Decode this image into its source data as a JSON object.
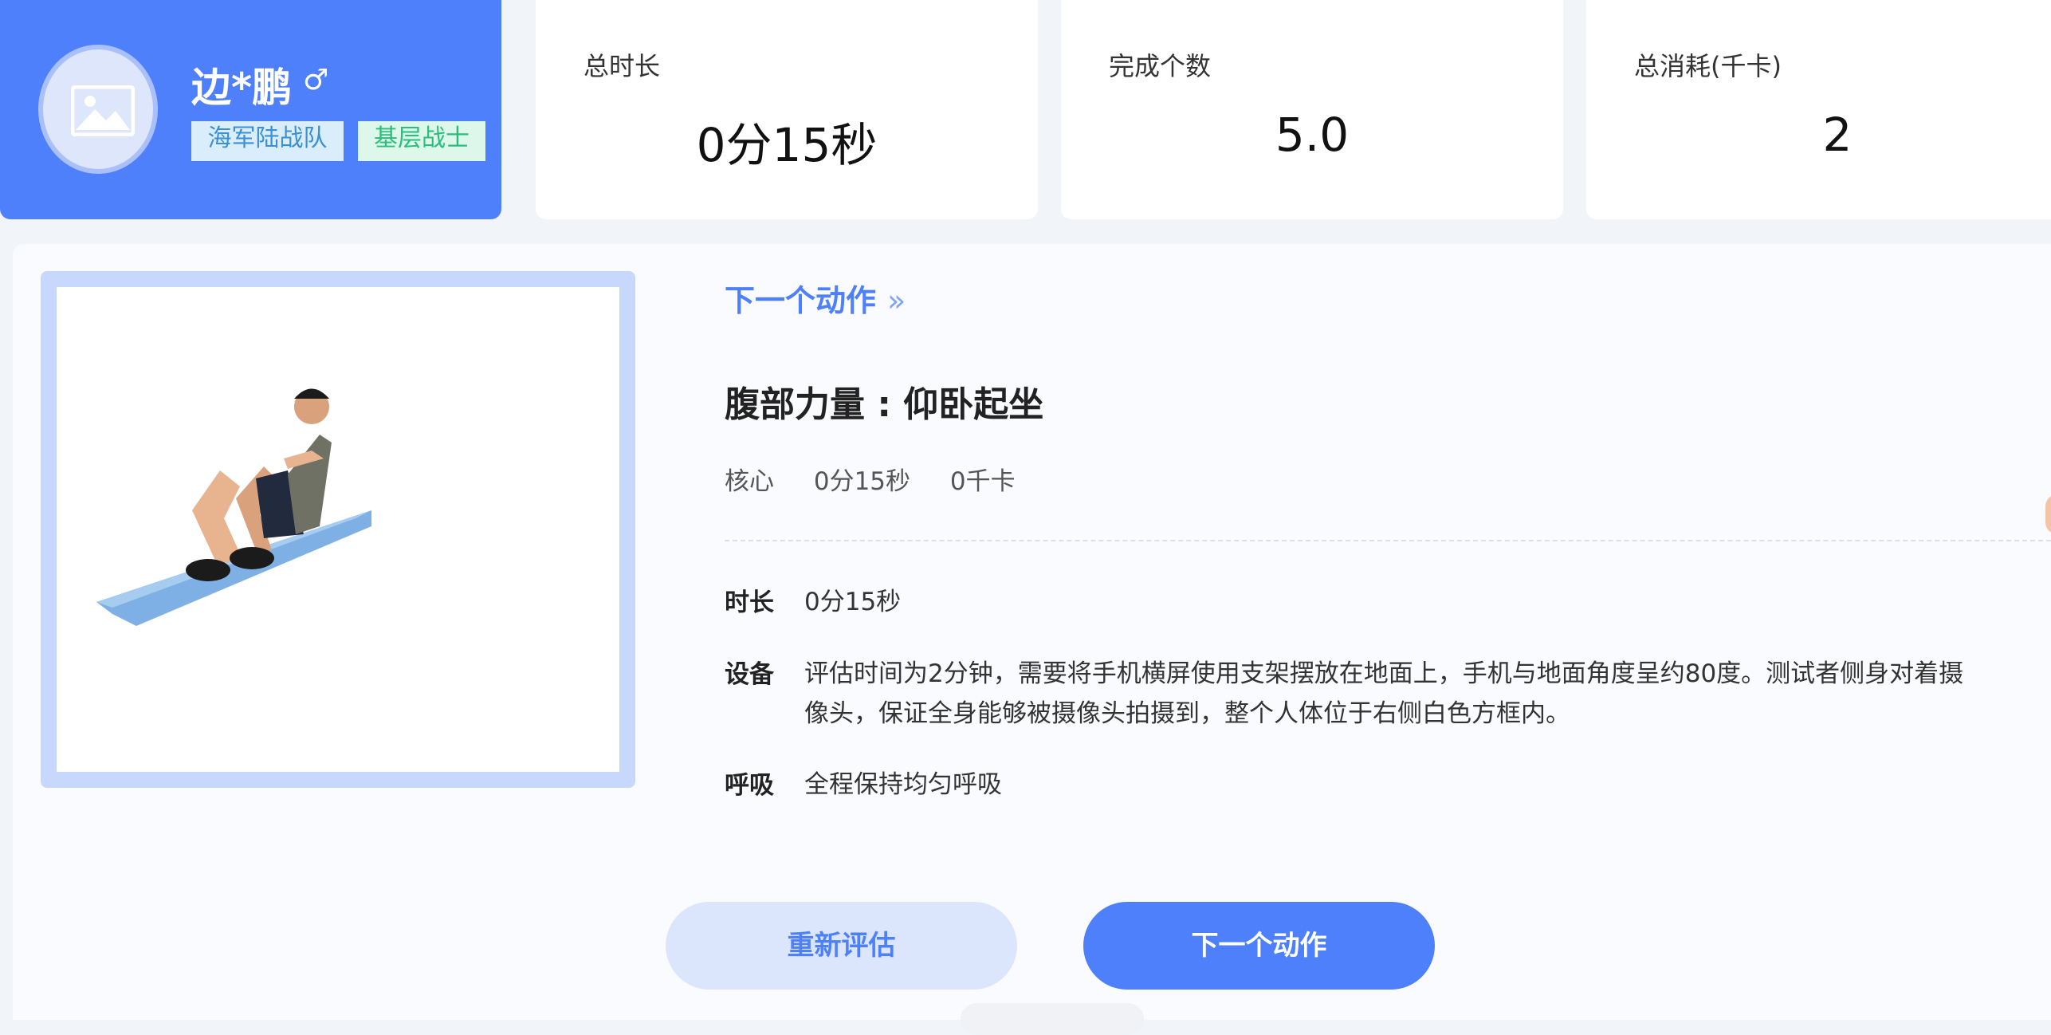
{
  "user": {
    "name": "边*鹏",
    "gender_symbol": "♂",
    "tags": [
      "海军陆战队",
      "基层战士"
    ]
  },
  "stats": {
    "duration": {
      "label": "总时长",
      "value": "0分15秒"
    },
    "count": {
      "label": "完成个数",
      "value": "5.0"
    },
    "calories": {
      "label": "总消耗(千卡)",
      "value": "2"
    }
  },
  "exercise": {
    "next_link": "下一个动作",
    "next_link_icon": "double-chevron-right-icon",
    "title": "腹部力量 : 仰卧起坐",
    "meta": [
      "核心",
      "0分15秒",
      "0千卡"
    ],
    "duration_label": "时长",
    "duration_value": "0分15秒",
    "equipment_label": "设备",
    "equipment_value": "评估时间为2分钟，需要将手机横屏使用支架摆放在地面上，手机与地面角度呈约80度。测试者侧身对着摄像头，保证全身能够被摄像头拍摄到，整个人体位于右侧白色方框内。",
    "breath_label": "呼吸",
    "breath_value": "全程保持均匀呼吸"
  },
  "buttons": {
    "reassess": "重新评估",
    "next": "下一个动作"
  },
  "colors": {
    "primary": "#4f80fb",
    "primary_light": "#dbe6fd",
    "tag_unit_bg": "#d9edfb",
    "tag_role_bg": "#ddf7ea"
  }
}
